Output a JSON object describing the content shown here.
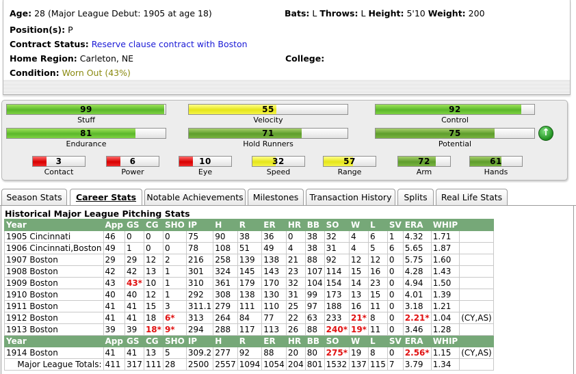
{
  "player": {
    "age_label": "Age:",
    "age": "28",
    "debut": "(Major League Debut: 1905 at age 18)",
    "bats_label": "Bats:",
    "bats": "L",
    "throws_label": "Throws:",
    "throws": "L",
    "height_label": "Height:",
    "height": "5'10",
    "weight_label": "Weight:",
    "weight": "200",
    "positions_label": "Position(s):",
    "positions": "P",
    "contract_label": "Contract Status:",
    "contract": "Reserve clause contract with Boston",
    "region_label": "Home Region:",
    "region": "Carleton, NE",
    "college_label": "College:",
    "college": "",
    "condition_label": "Condition:",
    "condition": "Worn Out (43%)"
  },
  "ratings": {
    "main": [
      {
        "label": "Stuff",
        "value": "99",
        "fill": 0.99,
        "color": "green"
      },
      {
        "label": "Velocity",
        "value": "55",
        "fill": 0.55,
        "color": "yellow"
      },
      {
        "label": "Control",
        "value": "92",
        "fill": 0.92,
        "color": "green"
      },
      {
        "label": "Endurance",
        "value": "81",
        "fill": 0.81,
        "color": "green"
      },
      {
        "label": "Hold Runners",
        "value": "71",
        "fill": 0.71,
        "color": "dgreen"
      },
      {
        "label": "Potential",
        "value": "75",
        "fill": 0.75,
        "color": "dgreen"
      }
    ],
    "small": [
      {
        "label": "Contact",
        "value": "3",
        "fill": 0.26,
        "color": "red"
      },
      {
        "label": "Power",
        "value": "6",
        "fill": 0.26,
        "color": "red"
      },
      {
        "label": "Eye",
        "value": "10",
        "fill": 0.26,
        "color": "red"
      },
      {
        "label": "Speed",
        "value": "32",
        "fill": 0.45,
        "color": "yellow"
      },
      {
        "label": "Range",
        "value": "57",
        "fill": 0.57,
        "color": "yellow"
      },
      {
        "label": "Arm",
        "value": "72",
        "fill": 0.72,
        "color": "dgreen"
      },
      {
        "label": "Hands",
        "value": "61",
        "fill": 0.61,
        "color": "dgreen"
      }
    ],
    "potential_icon": "arrow-up-icon",
    "potential_glyph": "↑"
  },
  "tabs": [
    {
      "label": "Season Stats",
      "active": false
    },
    {
      "label": "Career Stats",
      "active": true
    },
    {
      "label": "Notable Achievements",
      "active": false
    },
    {
      "label": "Milestones",
      "active": false
    },
    {
      "label": "Transaction History",
      "active": false
    },
    {
      "label": "Splits",
      "active": false
    },
    {
      "label": "Real Life Stats",
      "active": false
    }
  ],
  "stats": {
    "title": "Historical Major League Pitching Stats",
    "headers": [
      "Year",
      "App",
      "GS",
      "CG",
      "SHO",
      "IP",
      "H",
      "R",
      "ER",
      "HR",
      "BB",
      "SO",
      "W",
      "L",
      "SV",
      "ERA",
      "WHIP",
      ""
    ],
    "rows_a": [
      [
        "1905 Cincinnati",
        "46",
        "0",
        "0",
        "0",
        "75",
        "90",
        "38",
        "36",
        "0",
        "38",
        "32",
        "4",
        "6",
        "1",
        "4.32",
        "1.71",
        ""
      ],
      [
        "1906 Cincinnati,Boston",
        "49",
        "1",
        "0",
        "0",
        "78",
        "108",
        "51",
        "49",
        "4",
        "38",
        "31",
        "4",
        "5",
        "6",
        "5.65",
        "1.87",
        ""
      ],
      [
        "1907 Boston",
        "29",
        "29",
        "12",
        "2",
        "216",
        "258",
        "139",
        "138",
        "21",
        "88",
        "92",
        "12",
        "12",
        "0",
        "5.75",
        "1.60",
        ""
      ],
      [
        "1908 Boston",
        "42",
        "42",
        "13",
        "1",
        "301",
        "324",
        "145",
        "143",
        "23",
        "107",
        "114",
        "15",
        "16",
        "0",
        "4.28",
        "1.43",
        ""
      ],
      [
        "1909 Boston",
        "43",
        "43*",
        "10",
        "1",
        "310",
        "361",
        "179",
        "170",
        "32",
        "104",
        "154",
        "14",
        "23",
        "0",
        "4.94",
        "1.50",
        ""
      ],
      [
        "1910 Boston",
        "40",
        "40",
        "12",
        "1",
        "292",
        "308",
        "138",
        "130",
        "31",
        "99",
        "173",
        "13",
        "15",
        "0",
        "4.01",
        "1.39",
        ""
      ],
      [
        "1911 Boston",
        "41",
        "41",
        "15",
        "3",
        "311.1",
        "279",
        "111",
        "110",
        "25",
        "97",
        "188",
        "16",
        "11",
        "0",
        "3.18",
        "1.21",
        ""
      ],
      [
        "1912 Boston",
        "41",
        "41",
        "18",
        "6*",
        "313",
        "264",
        "84",
        "77",
        "22",
        "63",
        "233",
        "21*",
        "8",
        "0",
        "2.21*",
        "1.04",
        "(CY,AS)"
      ],
      [
        "1913 Boston",
        "39",
        "39",
        "18*",
        "9*",
        "294",
        "288",
        "117",
        "113",
        "26",
        "88",
        "240*",
        "19*",
        "11",
        "0",
        "3.46",
        "1.28",
        ""
      ]
    ],
    "rows_b": [
      [
        "1914 Boston",
        "41",
        "41",
        "13",
        "5",
        "309.2",
        "277",
        "92",
        "88",
        "20",
        "80",
        "275*",
        "19",
        "8",
        "0",
        "2.56*",
        "1.15",
        "(CY,AS)"
      ]
    ],
    "totals": [
      "Major League Totals:",
      "411",
      "317",
      "111",
      "28",
      "2500",
      "2557",
      "1094",
      "1054",
      "204",
      "801",
      "1532",
      "137",
      "115",
      "7",
      "3.79",
      "1.34",
      ""
    ]
  }
}
